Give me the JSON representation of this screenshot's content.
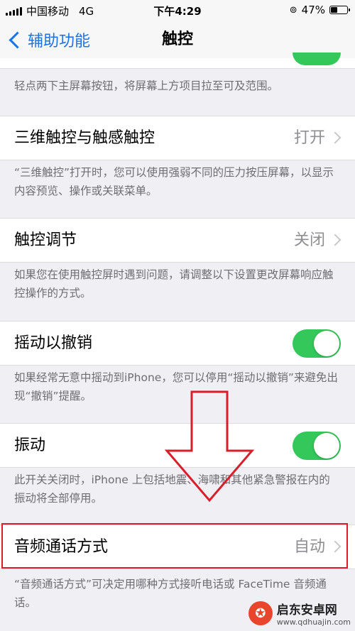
{
  "status": {
    "carrier": "中国移动",
    "network": "4G",
    "time": "下午4:29",
    "battery": "47%",
    "battery_level": 0.47
  },
  "nav": {
    "back_label": "辅助功能",
    "title": "触控"
  },
  "sections": {
    "reachability_footer": "轻点两下主屏幕按钮，将屏幕上方项目拉至可及范围。",
    "touch3d": {
      "label": "三维触控与触感触控",
      "value": "打开",
      "footer": "“三维触控”打开时，您可以使用强弱不同的压力按压屏幕，以显示内容预览、操作或关联菜单。"
    },
    "touch_accommodations": {
      "label": "触控调节",
      "value": "关闭",
      "footer": "如果您在使用触控屏时遇到问题，请调整以下设置更改屏幕响应触控操作的方式。"
    },
    "shake_to_undo": {
      "label": "摇动以撤销",
      "on": true,
      "footer": "如果经常无意中摇动到iPhone，您可以停用“摇动以撤销”来避免出现“撤销”提醒。"
    },
    "vibration": {
      "label": "振动",
      "on": true,
      "footer": "此开关关闭时，iPhone 上包括地震、海啸和其他紧急警报在内的振动将全部停用。"
    },
    "call_audio_routing": {
      "label": "音频通话方式",
      "value": "自动",
      "footer": "“音频通话方式”可决定用哪种方式接听电话或 FaceTime 音频通话。"
    }
  },
  "watermark": {
    "name": "启东安卓网",
    "url": "www.qdhuajin.com"
  },
  "colors": {
    "accent": "#1a73e8",
    "toggle_on": "#34c759",
    "annotation_red": "#d81e2a"
  }
}
